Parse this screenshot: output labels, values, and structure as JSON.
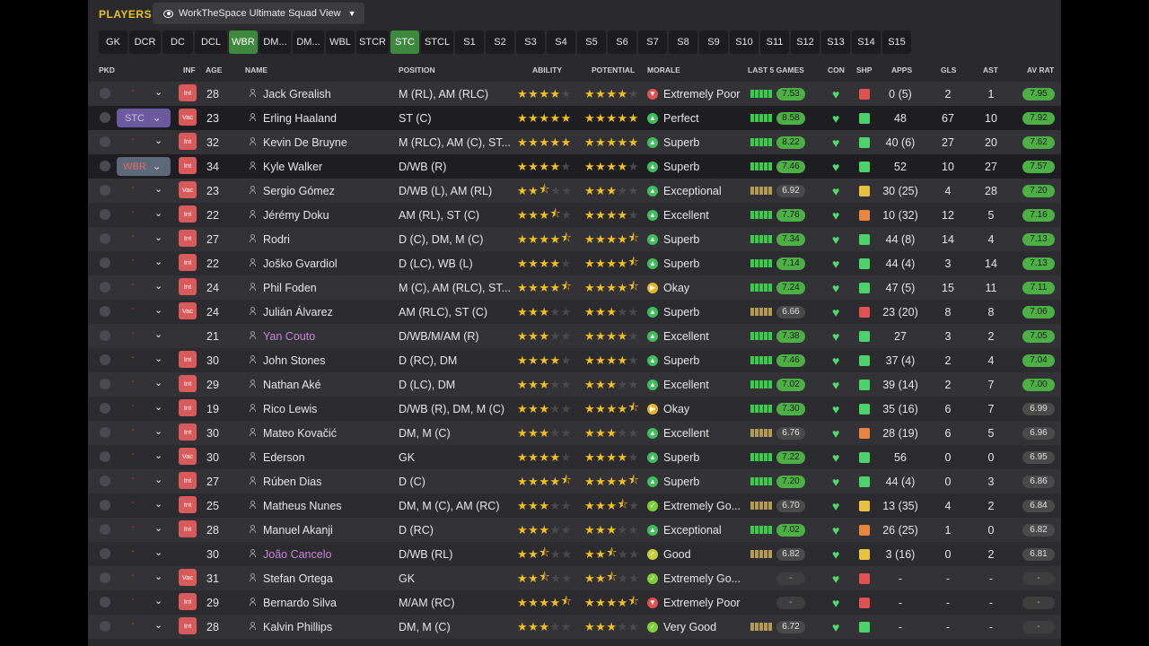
{
  "title": "PLAYERS",
  "view": "WorkTheSpace Ultimate Squad View",
  "tabs": [
    "GK",
    "DCR",
    "DC",
    "DCL",
    "WBR",
    "DM...",
    "DM...",
    "WBL",
    "STCR",
    "STC",
    "STCL",
    "S1",
    "S2",
    "S3",
    "S4",
    "S5",
    "S6",
    "S7",
    "S8",
    "S9",
    "S10",
    "S11",
    "S12",
    "S13",
    "S14",
    "S15"
  ],
  "active_tabs": [
    "WBR",
    "STC"
  ],
  "columns": {
    "pkd": "PKD",
    "inf": "INF",
    "age": "AGE",
    "name": "NAME",
    "position": "POSITION",
    "ability": "ABILITY",
    "potential": "POTENTIAL",
    "morale": "MORALE",
    "last5": "LAST 5 GAMES",
    "con": "CON",
    "shp": "SHP",
    "apps": "APPS",
    "gls": "GLS",
    "ast": "AST",
    "avrat": "AV RAT"
  },
  "colors": {
    "accent": "#e6c229",
    "active_tab": "#3d8a3f",
    "rating_green": "#4cb045",
    "inf_red": "#d95a5a",
    "loan_name": "#c985d8"
  },
  "players": [
    {
      "pick": "",
      "inf": "Int",
      "age": "28",
      "name": "Jack Grealish",
      "position": "M (RL), AM (RLC)",
      "ability": 4,
      "potential": 4,
      "morale": "Extremely Poor",
      "form": "7.53",
      "con": "good",
      "shp": "red",
      "apps": "0 (5)",
      "gls": "2",
      "ast": "1",
      "avrat": "7.95",
      "loan": false
    },
    {
      "pick": "STC",
      "inf": "Vac",
      "age": "23",
      "name": "Erling Haaland",
      "position": "ST (C)",
      "ability": 5,
      "potential": 5,
      "morale": "Perfect",
      "form": "8.58",
      "con": "good",
      "shp": "green",
      "apps": "48",
      "gls": "67",
      "ast": "10",
      "avrat": "7.92",
      "loan": false
    },
    {
      "pick": "",
      "inf": "Int",
      "age": "32",
      "name": "Kevin De Bruyne",
      "position": "M (RLC), AM (C), ST...",
      "ability": 5,
      "potential": 5,
      "morale": "Superb",
      "form": "8.22",
      "con": "good",
      "shp": "green",
      "apps": "40 (6)",
      "gls": "27",
      "ast": "20",
      "avrat": "7.62",
      "loan": false
    },
    {
      "pick": "WBR",
      "inf": "Int",
      "age": "34",
      "name": "Kyle Walker",
      "position": "D/WB (R)",
      "ability": 4,
      "potential": 4,
      "morale": "Superb",
      "form": "7.46",
      "con": "good",
      "shp": "green",
      "apps": "52",
      "gls": "10",
      "ast": "27",
      "avrat": "7.57",
      "loan": false
    },
    {
      "pick": "",
      "inf": "Vac",
      "age": "23",
      "name": "Sergio Gómez",
      "position": "D/WB (L), AM (RL)",
      "ability": 2.5,
      "potential": 3,
      "morale": "Exceptional",
      "form": "6.92",
      "con": "good",
      "shp": "yellow",
      "apps": "30 (25)",
      "gls": "4",
      "ast": "28",
      "avrat": "7.20",
      "loan": false
    },
    {
      "pick": "",
      "inf": "Int",
      "age": "22",
      "name": "Jérémy Doku",
      "position": "AM (RL), ST (C)",
      "ability": 3.5,
      "potential": 4,
      "morale": "Excellent",
      "form": "7.76",
      "con": "good",
      "shp": "orange",
      "apps": "10 (32)",
      "gls": "12",
      "ast": "5",
      "avrat": "7.16",
      "loan": false
    },
    {
      "pick": "",
      "inf": "Int",
      "age": "27",
      "name": "Rodri",
      "position": "D (C), DM, M (C)",
      "ability": 4.5,
      "potential": 4.5,
      "morale": "Superb",
      "form": "7.34",
      "con": "good",
      "shp": "green",
      "apps": "44 (8)",
      "gls": "14",
      "ast": "4",
      "avrat": "7.13",
      "loan": false
    },
    {
      "pick": "",
      "inf": "Int",
      "age": "22",
      "name": "Joško Gvardiol",
      "position": "D (LC), WB (L)",
      "ability": 4,
      "potential": 4.5,
      "morale": "Superb",
      "form": "7.14",
      "con": "good",
      "shp": "green",
      "apps": "44 (4)",
      "gls": "3",
      "ast": "14",
      "avrat": "7.13",
      "loan": false
    },
    {
      "pick": "",
      "inf": "Int",
      "age": "24",
      "name": "Phil Foden",
      "position": "M (C), AM (RLC), ST...",
      "ability": 4.5,
      "potential": 4.5,
      "morale": "Okay",
      "form": "7.24",
      "con": "good",
      "shp": "green",
      "apps": "47 (5)",
      "gls": "15",
      "ast": "11",
      "avrat": "7.11",
      "loan": false
    },
    {
      "pick": "",
      "inf": "Vac",
      "age": "24",
      "name": "Julián Álvarez",
      "position": "AM (RLC), ST (C)",
      "ability": 3,
      "potential": 3,
      "morale": "Superb",
      "form": "6.66",
      "con": "good",
      "shp": "red",
      "apps": "23 (20)",
      "gls": "8",
      "ast": "8",
      "avrat": "7.06",
      "loan": false
    },
    {
      "pick": "",
      "inf": "",
      "age": "21",
      "name": "Yan Couto",
      "position": "D/WB/M/AM (R)",
      "ability": 3,
      "potential": 4,
      "morale": "Excellent",
      "form": "7.38",
      "con": "good",
      "shp": "green",
      "apps": "27",
      "gls": "3",
      "ast": "2",
      "avrat": "7.05",
      "loan": true
    },
    {
      "pick": "",
      "inf": "Int",
      "age": "30",
      "name": "John Stones",
      "position": "D (RC), DM",
      "ability": 4,
      "potential": 4,
      "morale": "Superb",
      "form": "7.46",
      "con": "good",
      "shp": "green",
      "apps": "37 (4)",
      "gls": "2",
      "ast": "4",
      "avrat": "7.04",
      "loan": false
    },
    {
      "pick": "",
      "inf": "Int",
      "age": "29",
      "name": "Nathan Aké",
      "position": "D (LC), DM",
      "ability": 3,
      "potential": 3,
      "morale": "Excellent",
      "form": "7.02",
      "con": "good",
      "shp": "green",
      "apps": "39 (14)",
      "gls": "2",
      "ast": "7",
      "avrat": "7.00",
      "loan": false
    },
    {
      "pick": "",
      "inf": "Int",
      "age": "19",
      "name": "Rico Lewis",
      "position": "D/WB (R), DM, M (C)",
      "ability": 3,
      "potential": 4.5,
      "morale": "Okay",
      "form": "7.30",
      "con": "good",
      "shp": "green",
      "apps": "35 (16)",
      "gls": "6",
      "ast": "7",
      "avrat": "6.99",
      "loan": false
    },
    {
      "pick": "",
      "inf": "Int",
      "age": "30",
      "name": "Mateo Kovačić",
      "position": "DM, M (C)",
      "ability": 3,
      "potential": 3,
      "morale": "Excellent",
      "form": "6.76",
      "con": "good",
      "shp": "orange",
      "apps": "28 (19)",
      "gls": "6",
      "ast": "5",
      "avrat": "6.96",
      "loan": false
    },
    {
      "pick": "",
      "inf": "Vac",
      "age": "30",
      "name": "Ederson",
      "position": "GK",
      "ability": 4,
      "potential": 4,
      "morale": "Superb",
      "form": "7.22",
      "con": "good",
      "shp": "green",
      "apps": "56",
      "gls": "0",
      "ast": "0",
      "avrat": "6.95",
      "loan": false
    },
    {
      "pick": "",
      "inf": "Int",
      "age": "27",
      "name": "Rúben Dias",
      "position": "D (C)",
      "ability": 4.5,
      "potential": 4.5,
      "morale": "Superb",
      "form": "7.20",
      "con": "good",
      "shp": "green",
      "apps": "44 (4)",
      "gls": "0",
      "ast": "3",
      "avrat": "6.86",
      "loan": false
    },
    {
      "pick": "",
      "inf": "Int",
      "age": "25",
      "name": "Matheus Nunes",
      "position": "DM, M (C), AM (RC)",
      "ability": 3,
      "potential": 3.5,
      "morale": "Extremely Go...",
      "form": "6.70",
      "con": "good",
      "shp": "yellow",
      "apps": "13 (35)",
      "gls": "4",
      "ast": "2",
      "avrat": "6.84",
      "loan": false
    },
    {
      "pick": "",
      "inf": "Int",
      "age": "28",
      "name": "Manuel Akanji",
      "position": "D (RC)",
      "ability": 3,
      "potential": 3,
      "morale": "Exceptional",
      "form": "7.02",
      "con": "good",
      "shp": "orange",
      "apps": "26 (25)",
      "gls": "1",
      "ast": "0",
      "avrat": "6.82",
      "loan": false
    },
    {
      "pick": "",
      "inf": "",
      "age": "30",
      "name": "João Cancelo",
      "position": "D/WB (RL)",
      "ability": 2.5,
      "potential": 2.5,
      "morale": "Good",
      "form": "6.82",
      "con": "good",
      "shp": "yellow",
      "apps": "3 (16)",
      "gls": "0",
      "ast": "2",
      "avrat": "6.81",
      "loan": true
    },
    {
      "pick": "",
      "inf": "Vac",
      "age": "31",
      "name": "Stefan Ortega",
      "position": "GK",
      "ability": 2.5,
      "potential": 2.5,
      "morale": "Extremely Go...",
      "form": "-",
      "con": "good",
      "shp": "red",
      "apps": "-",
      "gls": "-",
      "ast": "-",
      "avrat": "-",
      "loan": false
    },
    {
      "pick": "",
      "inf": "Int",
      "age": "29",
      "name": "Bernardo Silva",
      "position": "M/AM (RC)",
      "ability": 4.5,
      "potential": 4.5,
      "morale": "Extremely Poor",
      "form": "-",
      "con": "good",
      "shp": "red",
      "apps": "-",
      "gls": "-",
      "ast": "-",
      "avrat": "-",
      "loan": false
    },
    {
      "pick": "",
      "inf": "Int",
      "age": "28",
      "name": "Kalvin Phillips",
      "position": "DM, M (C)",
      "ability": 3,
      "potential": 3,
      "morale": "Very Good",
      "form": "6.72",
      "con": "good",
      "shp": "green",
      "apps": "-",
      "gls": "-",
      "ast": "-",
      "avrat": "-",
      "loan": false
    }
  ]
}
